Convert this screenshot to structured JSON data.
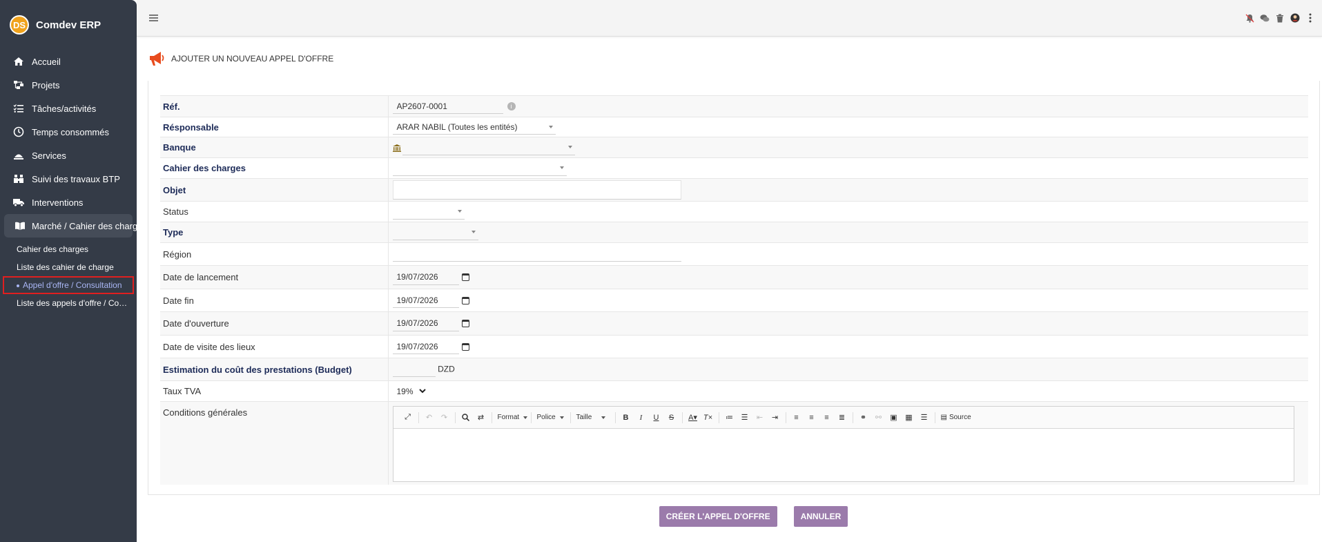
{
  "app": {
    "name": "Comdev ERP",
    "logo_text": "DS"
  },
  "sidebar": {
    "items": [
      {
        "label": "Accueil",
        "icon": "home-icon"
      },
      {
        "label": "Projets",
        "icon": "project-tree-icon"
      },
      {
        "label": "Tâches/activités",
        "icon": "tasks-icon"
      },
      {
        "label": "Temps consommés",
        "icon": "clock-icon"
      },
      {
        "label": "Services",
        "icon": "services-icon"
      },
      {
        "label": "Suivi des travaux BTP",
        "icon": "binoculars-icon"
      },
      {
        "label": "Interventions",
        "icon": "truck-icon"
      },
      {
        "label": "Marché / Cahier des charges",
        "icon": "book-icon"
      }
    ],
    "sub_items": [
      {
        "label": "Cahier des charges"
      },
      {
        "label": "Liste des cahier de charge"
      },
      {
        "label": "Appel d'offre / Consultation"
      },
      {
        "label": "Liste des appels d'offre / Consultation"
      }
    ]
  },
  "topbar": {
    "icons": [
      "bell-slash-icon",
      "comments-icon",
      "trash-icon",
      "user-avatar",
      "kebab-menu-icon"
    ]
  },
  "page": {
    "title": "AJOUTER UN NOUVEAU APPEL D'OFFRE"
  },
  "form": {
    "ref": {
      "label": "Réf.",
      "value": "AP2607-0001"
    },
    "responsable": {
      "label": "Résponsable",
      "value": "ARAR NABIL (Toutes les entités)"
    },
    "banque": {
      "label": "Banque",
      "value": ""
    },
    "cahier": {
      "label": "Cahier des charges",
      "value": ""
    },
    "objet": {
      "label": "Objet",
      "value": ""
    },
    "status": {
      "label": "Status",
      "value": ""
    },
    "type": {
      "label": "Type",
      "value": ""
    },
    "region": {
      "label": "Région",
      "value": ""
    },
    "date_lancement": {
      "label": "Date de lancement",
      "value": "19/07/2026"
    },
    "date_fin": {
      "label": "Date fin",
      "value": "19/07/2026"
    },
    "date_ouverture": {
      "label": "Date d'ouverture",
      "value": "19/07/2026"
    },
    "date_visite": {
      "label": "Date de visite des lieux",
      "value": "19/07/2026"
    },
    "budget": {
      "label": "Estimation du coût des prestations (Budget)",
      "value": "",
      "currency": "DZD"
    },
    "tva": {
      "label": "Taux TVA",
      "value": "19%"
    },
    "conditions": {
      "label": "Conditions générales"
    }
  },
  "editor": {
    "format": "Format",
    "police": "Police",
    "taille": "Taille",
    "source": "Source"
  },
  "actions": {
    "create": "CRÉER L'APPEL D'OFFRE",
    "cancel": "ANNULER"
  }
}
